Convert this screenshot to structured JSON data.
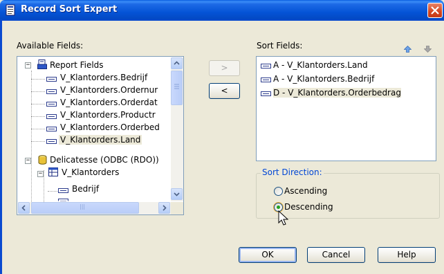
{
  "window": {
    "title": "Record Sort Expert"
  },
  "available": {
    "label": "Available Fields:",
    "tree": [
      {
        "text": "Report Fields",
        "icon": "report-fields-icon"
      },
      {
        "text": "V_Klantorders.Bedrijf",
        "icon": "field-icon"
      },
      {
        "text": "V_Klantorders.Ordernur",
        "icon": "field-icon"
      },
      {
        "text": "V_Klantorders.Orderdat",
        "icon": "field-icon"
      },
      {
        "text": "V_Klantorders.Productr",
        "icon": "field-icon"
      },
      {
        "text": "V_Klantorders.Orderbed",
        "icon": "field-icon"
      },
      {
        "text": "V_Klantorders.Land",
        "icon": "field-icon"
      },
      {
        "text": "Delicatesse (ODBC (RDO))",
        "icon": "database-icon"
      },
      {
        "text": "V_Klantorders",
        "icon": "table-icon"
      },
      {
        "text": "Bedrijf",
        "icon": "field-icon"
      }
    ],
    "hscroll_grip": "|||"
  },
  "move": {
    "add": ">",
    "remove": "<"
  },
  "sort": {
    "label": "Sort Fields:",
    "items": [
      {
        "text": "A - V_Klantorders.Land"
      },
      {
        "text": "A - V_Klantorders.Bedrijf"
      },
      {
        "text": "D - V_Klantorders.Orderbedrag"
      }
    ]
  },
  "direction": {
    "label": "Sort Direction:",
    "ascending": "Ascending",
    "descending": "Descending",
    "selected": "descending"
  },
  "buttons": {
    "ok": "OK",
    "cancel": "Cancel",
    "help": "Help"
  },
  "colors": {
    "title_bar": "#0453d6",
    "dialog_bg": "#ece9d8",
    "selected_radio": "#21a121"
  }
}
